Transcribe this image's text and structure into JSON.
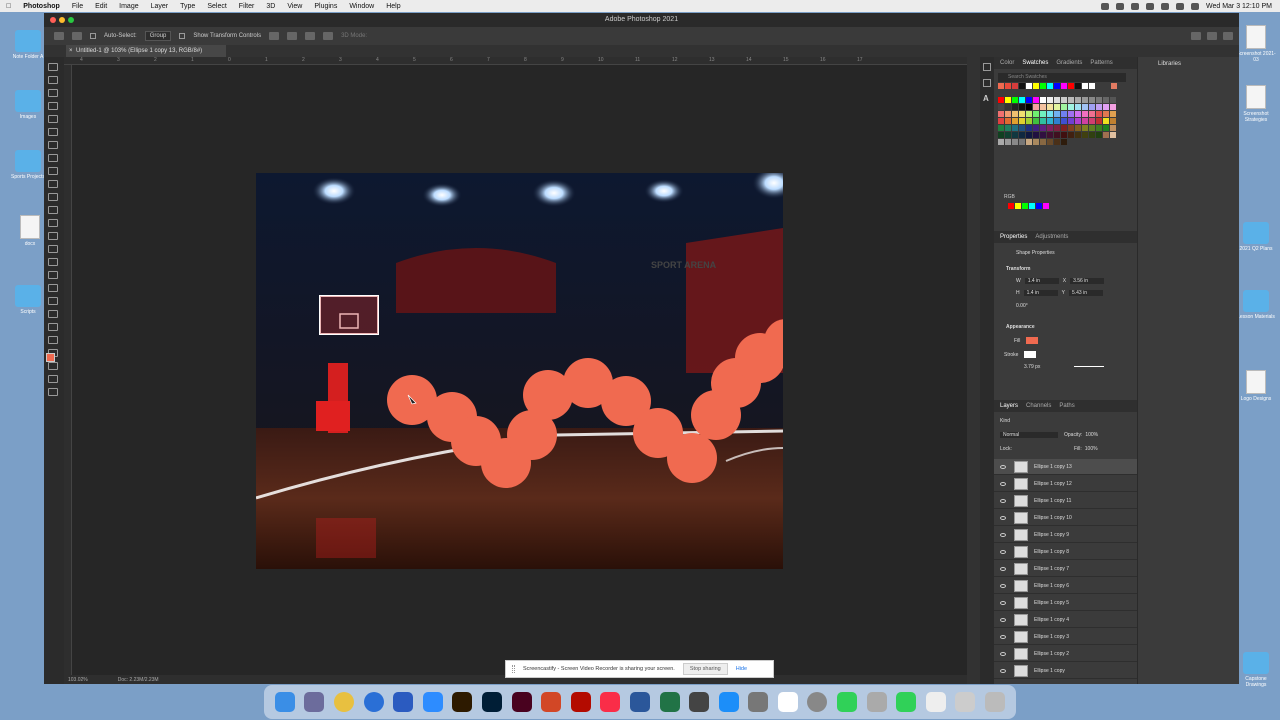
{
  "menubar": {
    "items": [
      "Photoshop",
      "File",
      "Edit",
      "Image",
      "Layer",
      "Type",
      "Select",
      "Filter",
      "3D",
      "View",
      "Plugins",
      "Window",
      "Help"
    ],
    "clock": "Wed Mar 3  12:10 PM"
  },
  "window": {
    "title": "Adobe Photoshop 2021",
    "doc_tab": "Untitled-1 @ 103% (Ellipse 1 copy 13, RGB/8#)"
  },
  "options_bar": {
    "auto_select": "Auto-Select:",
    "group": "Group",
    "transform_controls": "Show Transform Controls",
    "mode_3d": "3D Mode:"
  },
  "status_bar": {
    "zoom": "103.02%",
    "doc": "Doc: 2.23M/2.23M"
  },
  "ruler_ticks": [
    "4",
    "3",
    "2",
    "1",
    "0",
    "1",
    "2",
    "3",
    "4",
    "5",
    "6",
    "7",
    "8",
    "9",
    "10",
    "11",
    "12",
    "13",
    "14",
    "15",
    "16",
    "17"
  ],
  "swatches_panel": {
    "tabs": [
      "Color",
      "Swatches",
      "Gradients",
      "Patterns"
    ],
    "active_tab": "Swatches",
    "search_placeholder": "Search Swatches",
    "group_label": "RGB"
  },
  "properties_panel": {
    "tabs": [
      "Properties",
      "Adjustments"
    ],
    "active_tab": "Properties",
    "type_label": "Shape Properties",
    "transform_label": "Transform",
    "w_label": "W",
    "w_value": "1.4 in",
    "x_label": "X",
    "x_value": "3.56 in",
    "h_label": "H",
    "h_value": "1.4 in",
    "y_label": "Y",
    "y_value": "5.43 in",
    "angle_value": "0.00°",
    "appearance_label": "Appearance",
    "fill_label": "Fill",
    "stroke_label": "Stroke",
    "stroke_width": "3.79 px",
    "fill_color": "#f06a50"
  },
  "layers_panel": {
    "tabs": [
      "Layers",
      "Channels",
      "Paths"
    ],
    "active_tab": "Layers",
    "kind": "Kind",
    "blend_mode": "Normal",
    "opacity_label": "Opacity:",
    "opacity_value": "100%",
    "lock_label": "Lock:",
    "fill_label": "Fill:",
    "fill_value": "100%",
    "layers": [
      "Ellipse 1 copy 13",
      "Ellipse 1 copy 12",
      "Ellipse 1 copy 11",
      "Ellipse 1 copy 10",
      "Ellipse 1 copy 9",
      "Ellipse 1 copy 8",
      "Ellipse 1 copy 7",
      "Ellipse 1 copy 6",
      "Ellipse 1 copy 5",
      "Ellipse 1 copy 4",
      "Ellipse 1 copy 3",
      "Ellipse 1 copy 2",
      "Ellipse 1 copy"
    ],
    "selected_index": 0
  },
  "libraries_panel": {
    "title": "Libraries"
  },
  "canvas_text": {
    "arena": "SPORT ARENA"
  },
  "screen_share": {
    "message": "Screencastify - Screen Video Recorder is sharing your screen.",
    "stop_label": "Stop sharing",
    "hide_label": "Hide"
  },
  "desktop_icons": [
    {
      "label": "Note Folder A",
      "type": "folder"
    },
    {
      "label": "Images",
      "type": "folder"
    },
    {
      "label": "Sports Projects",
      "type": "folder"
    },
    {
      "label": "docx",
      "type": "doc"
    },
    {
      "label": "Scripts",
      "type": "folder"
    },
    {
      "label": "Screenshot 2021-03",
      "type": "doc"
    },
    {
      "label": "Screenshot Strategies",
      "type": "doc"
    },
    {
      "label": "2021 Q2 Plans",
      "type": "folder"
    },
    {
      "label": "Lesson Materials",
      "type": "folder"
    },
    {
      "label": "Logo Designs",
      "type": "doc"
    },
    {
      "label": "Capstone Drawings",
      "type": "folder"
    }
  ]
}
